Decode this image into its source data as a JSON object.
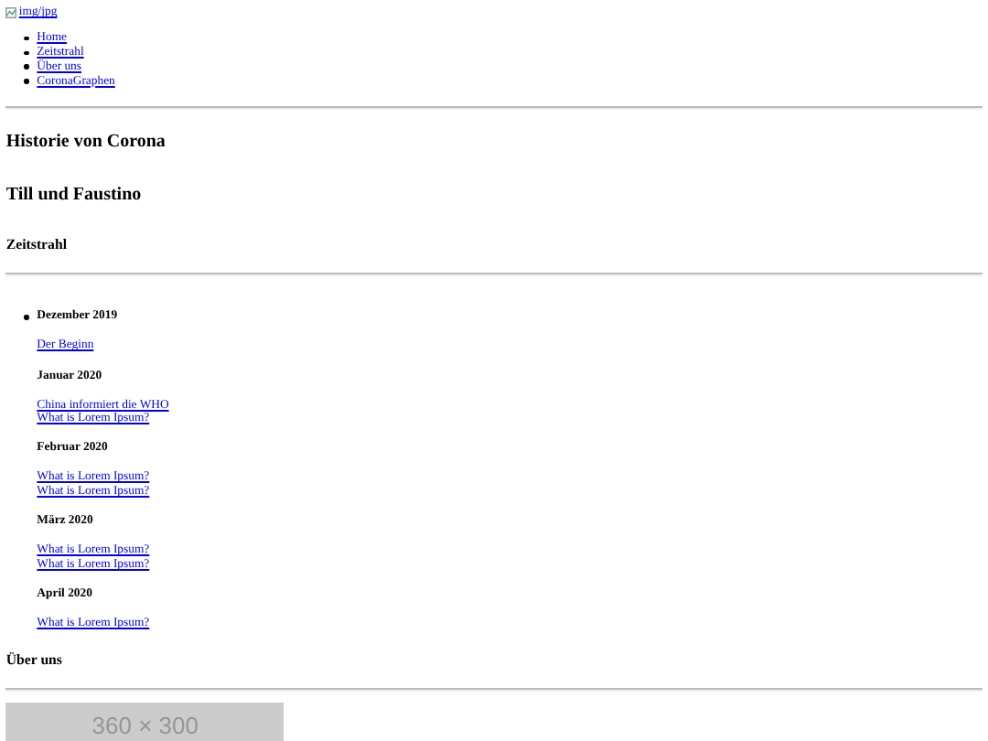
{
  "logo": {
    "alt": "img/jpg"
  },
  "nav": [
    {
      "label": "Home"
    },
    {
      "label": "Zeitstrahl"
    },
    {
      "label": "Über uns"
    },
    {
      "label": "CoronaGraphen"
    }
  ],
  "headings": [
    "Historie von Corona",
    "Till und Faustino"
  ],
  "timeline": {
    "title": "Zeitstrahl",
    "months": [
      {
        "month": "Dezember 2019",
        "links": [
          "Der Beginn"
        ]
      },
      {
        "month": "Januar 2020",
        "links": [
          "China informiert die WHO",
          "What is Lorem Ipsum?"
        ]
      },
      {
        "month": "Februar 2020",
        "links": [
          "What is Lorem Ipsum?",
          "What is Lorem Ipsum?"
        ]
      },
      {
        "month": "März 2020",
        "links": [
          "What is Lorem Ipsum?",
          "What is Lorem Ipsum?"
        ]
      },
      {
        "month": "April 2020",
        "links": [
          "What is Lorem Ipsum?"
        ]
      }
    ]
  },
  "about": {
    "title": "Über uns",
    "image_caption": "360 × 300"
  }
}
